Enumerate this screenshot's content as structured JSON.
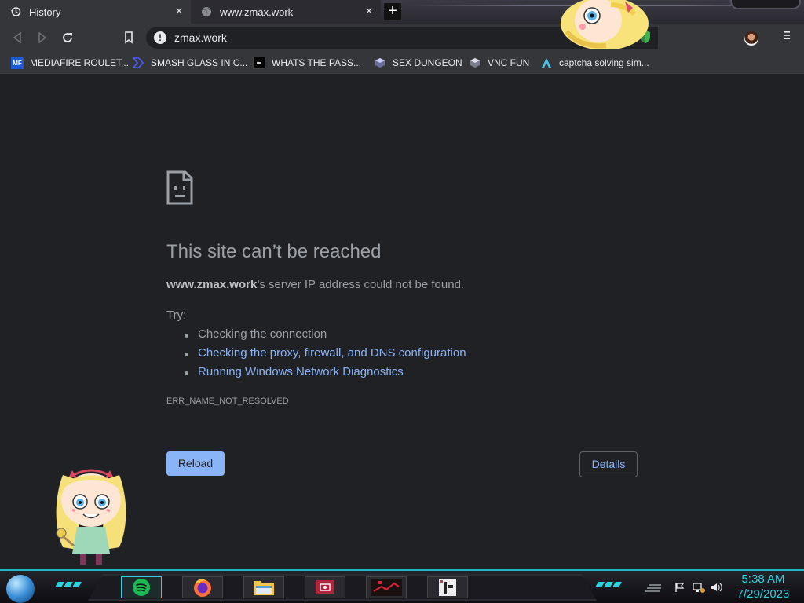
{
  "tabs": [
    {
      "label": "History",
      "icon": "history-icon",
      "close": "×"
    },
    {
      "label": "www.zmax.work",
      "icon": "globe-icon",
      "close": "×"
    }
  ],
  "new_tab_label": "+",
  "omnibox": {
    "url": "zmax.work",
    "info": "!"
  },
  "bookmarks": [
    {
      "label": "MEDIAFIRE ROULET...",
      "icon": "mediafire-icon"
    },
    {
      "label": "SMASH GLASS IN C...",
      "icon": "smash-icon"
    },
    {
      "label": "WHATS THE PASS...",
      "icon": "dark-square-icon"
    },
    {
      "label": "SEX DUNGEON",
      "icon": "virtualbox-icon"
    },
    {
      "label": "VNC FUN",
      "icon": "vnc-icon"
    },
    {
      "label": "captcha solving sim...",
      "icon": "arch-icon"
    }
  ],
  "error_page": {
    "title": "This site can’t be reached",
    "host": "www.zmax.work",
    "desc_suffix": "’s server IP address could not be found.",
    "try_label": "Try:",
    "suggestions": [
      {
        "text": "Checking the connection",
        "link": false
      },
      {
        "text": "Checking the proxy, firewall, and DNS configuration",
        "link": true
      },
      {
        "text": "Running Windows Network Diagnostics",
        "link": true
      }
    ],
    "error_code": "ERR_NAME_NOT_RESOLVED",
    "reload_label": "Reload",
    "details_label": "Details"
  },
  "taskbar": {
    "time": "5:38 AM",
    "date": "7/29/2023"
  },
  "colors": {
    "accent_link": "#8ab4f8",
    "taskbar_accent": "#2fd0e0",
    "page_bg": "#202124"
  }
}
